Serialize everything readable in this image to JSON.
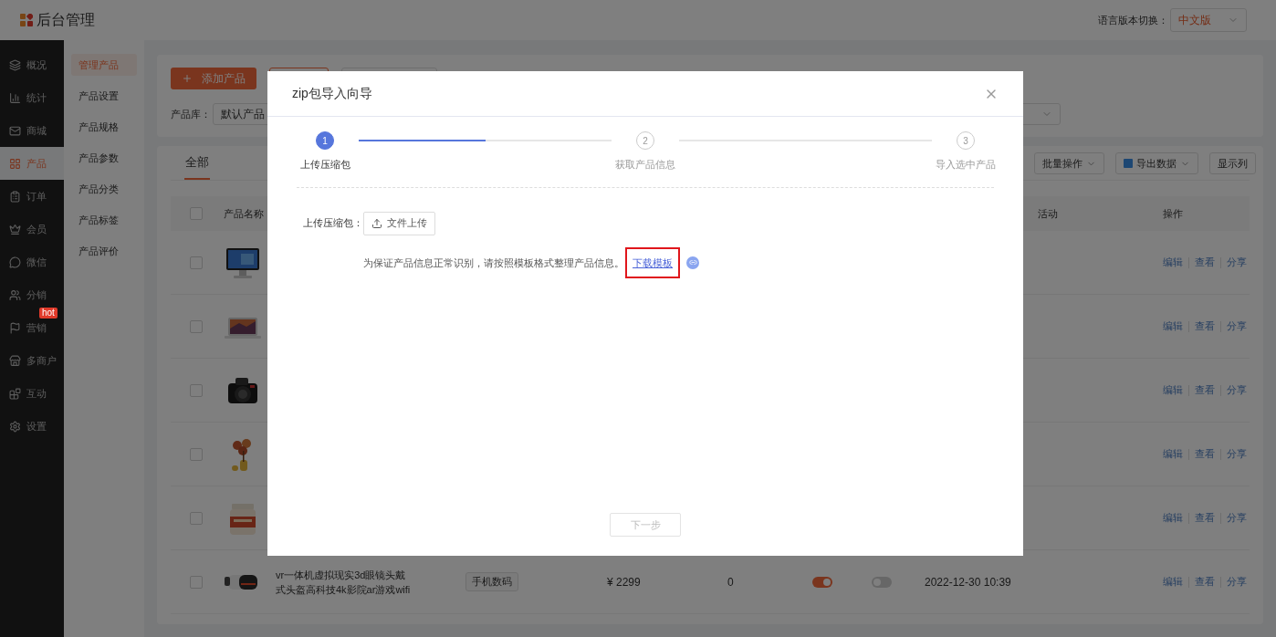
{
  "header": {
    "title": "后台管理",
    "language_label": "语言版本切换：",
    "language_select": "中文版"
  },
  "sidebar": {
    "items": [
      {
        "label": "概况",
        "selected": false
      },
      {
        "label": "统计",
        "selected": false
      },
      {
        "label": "商城",
        "selected": false
      },
      {
        "label": "产品",
        "selected": true
      },
      {
        "label": "订单",
        "selected": false
      },
      {
        "label": "会员",
        "selected": false
      },
      {
        "label": "微信",
        "selected": false
      },
      {
        "label": "分销",
        "selected": false
      },
      {
        "label": "营销",
        "selected": false,
        "badge": "hot"
      },
      {
        "label": "多商户",
        "selected": false
      },
      {
        "label": "互动",
        "selected": false
      },
      {
        "label": "设置",
        "selected": false
      }
    ]
  },
  "subnav": {
    "items": [
      {
        "label": "管理产品",
        "selected": true
      },
      {
        "label": "产品设置",
        "selected": false
      },
      {
        "label": "产品规格",
        "selected": false
      },
      {
        "label": "产品参数",
        "selected": false
      },
      {
        "label": "产品分类",
        "selected": false
      },
      {
        "label": "产品标签",
        "selected": false
      },
      {
        "label": "产品评价",
        "selected": false
      }
    ]
  },
  "toolbar": {
    "add_button": "添加产品",
    "library_label": "产品库：",
    "library_select": "默认产品"
  },
  "table": {
    "tabs": [
      {
        "label": "全部",
        "selected": true
      }
    ],
    "actions": [
      {
        "label": "批量操作",
        "kind": "dropdown"
      },
      {
        "label": "导出数据",
        "kind": "export"
      },
      {
        "label": "显示列",
        "kind": "plain"
      }
    ],
    "header_checked": false,
    "columns": {
      "name": "产品名称",
      "activity": "活动",
      "operations": "操作"
    },
    "rows": [
      {
        "checked": false,
        "actions": [
          "编辑",
          "查看",
          "分享"
        ]
      },
      {
        "checked": false,
        "actions": [
          "编辑",
          "查看",
          "分享"
        ]
      },
      {
        "checked": false,
        "actions": [
          "编辑",
          "查看",
          "分享"
        ]
      },
      {
        "checked": false,
        "actions": [
          "编辑",
          "查看",
          "分享"
        ]
      },
      {
        "checked": false,
        "actions": [
          "编辑",
          "查看",
          "分享"
        ]
      },
      {
        "checked": false,
        "name": "vr一体机虚拟现实3d眼镜头戴式头盔高科技4k影院ar游戏wifi",
        "tag": "手机数码",
        "price": "¥ 2299",
        "stock": "0",
        "toggle_1": {
          "on": true
        },
        "toggle_2": {
          "on": false
        },
        "date": "2022-12-30 10:39",
        "actions": [
          "编辑",
          "查看",
          "分享"
        ]
      }
    ]
  },
  "modal": {
    "title": "zip包导入向导",
    "steps": [
      {
        "number": "1",
        "label": "上传压缩包",
        "selected": true,
        "level": 0.5
      },
      {
        "number": "2",
        "label": "获取产品信息",
        "selected": false
      },
      {
        "number": "3",
        "label": "导入选中产品",
        "selected": false
      }
    ],
    "upload_label": "上传压缩包：",
    "upload_button": "文件上传",
    "hint": "为保证产品信息正常识别，请按照模板格式整理产品信息。",
    "template_link": {
      "label": "下载模板",
      "highlighted": true
    },
    "next_button": {
      "label": "下一步",
      "disabled": true
    }
  }
}
